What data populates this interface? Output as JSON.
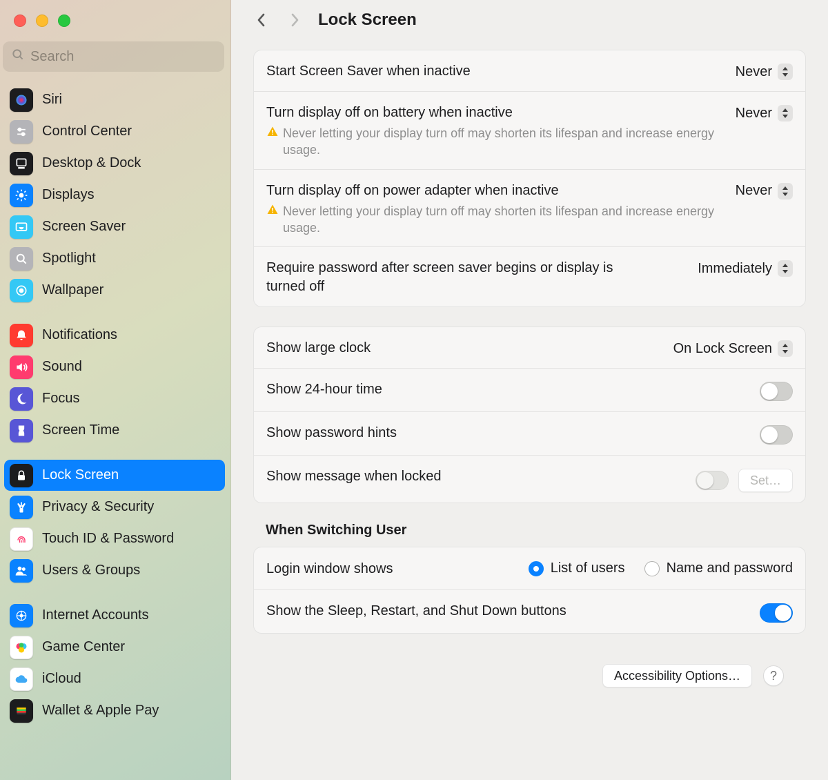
{
  "search": {
    "placeholder": "Search"
  },
  "header": {
    "title": "Lock Screen"
  },
  "sidebar": {
    "items": [
      {
        "id": "siri",
        "label": "Siri",
        "bg": "#1c1c1e",
        "icon": "siri"
      },
      {
        "id": "control-center",
        "label": "Control Center",
        "bg": "#b4b4b8",
        "icon": "control-center"
      },
      {
        "id": "desktop-dock",
        "label": "Desktop & Dock",
        "bg": "#1c1c1e",
        "icon": "desktop-dock"
      },
      {
        "id": "displays",
        "label": "Displays",
        "bg": "#0a82ff",
        "icon": "displays"
      },
      {
        "id": "screen-saver",
        "label": "Screen Saver",
        "bg": "#34c8f5",
        "icon": "screen-saver"
      },
      {
        "id": "spotlight",
        "label": "Spotlight",
        "bg": "#b4b4b8",
        "icon": "spotlight"
      },
      {
        "id": "wallpaper",
        "label": "Wallpaper",
        "bg": "#34c8f5",
        "icon": "wallpaper"
      },
      {
        "gap": true
      },
      {
        "id": "notifications",
        "label": "Notifications",
        "bg": "#ff3b30",
        "icon": "notifications"
      },
      {
        "id": "sound",
        "label": "Sound",
        "bg": "#ff3b6e",
        "icon": "sound"
      },
      {
        "id": "focus",
        "label": "Focus",
        "bg": "#5856d6",
        "icon": "focus"
      },
      {
        "id": "screen-time",
        "label": "Screen Time",
        "bg": "#5856d6",
        "icon": "screen-time"
      },
      {
        "gap": true
      },
      {
        "id": "lock-screen",
        "label": "Lock Screen",
        "bg": "#1c1c1e",
        "icon": "lock-screen",
        "selected": true
      },
      {
        "id": "privacy-security",
        "label": "Privacy & Security",
        "bg": "#0a82ff",
        "icon": "privacy"
      },
      {
        "id": "touch-id",
        "label": "Touch ID & Password",
        "bg": "#ffffff",
        "icon": "touch-id"
      },
      {
        "id": "users-groups",
        "label": "Users & Groups",
        "bg": "#0a82ff",
        "icon": "users"
      },
      {
        "gap": true
      },
      {
        "id": "internet-accounts",
        "label": "Internet Accounts",
        "bg": "#0a82ff",
        "icon": "internet"
      },
      {
        "id": "game-center",
        "label": "Game Center",
        "bg": "#ffffff",
        "icon": "game-center"
      },
      {
        "id": "icloud",
        "label": "iCloud",
        "bg": "#ffffff",
        "icon": "icloud"
      },
      {
        "id": "wallet",
        "label": "Wallet & Apple Pay",
        "bg": "#1c1c1e",
        "icon": "wallet"
      }
    ]
  },
  "group1": {
    "r0": {
      "label": "Start Screen Saver when inactive",
      "value": "Never"
    },
    "r1": {
      "label": "Turn display off on battery when inactive",
      "value": "Never",
      "sub": "Never letting your display turn off may shorten its lifespan and increase energy usage."
    },
    "r2": {
      "label": "Turn display off on power adapter when inactive",
      "value": "Never",
      "sub": "Never letting your display turn off may shorten its lifespan and increase energy usage."
    },
    "r3": {
      "label": "Require password after screen saver begins or display is turned off",
      "value": "Immediately"
    }
  },
  "group2": {
    "r0": {
      "label": "Show large clock",
      "value": "On Lock Screen"
    },
    "r1": {
      "label": "Show 24-hour time",
      "on": false
    },
    "r2": {
      "label": "Show password hints",
      "on": false
    },
    "r3": {
      "label": "Show message when locked",
      "on": false,
      "button": "Set…"
    }
  },
  "switching": {
    "heading": "When Switching User",
    "r0": {
      "label": "Login window shows",
      "opt1": "List of users",
      "opt2": "Name and password",
      "selected": 1
    },
    "r1": {
      "label": "Show the Sleep, Restart, and Shut Down buttons",
      "on": true
    }
  },
  "footer": {
    "accessibility": "Accessibility Options…",
    "help": "?"
  }
}
